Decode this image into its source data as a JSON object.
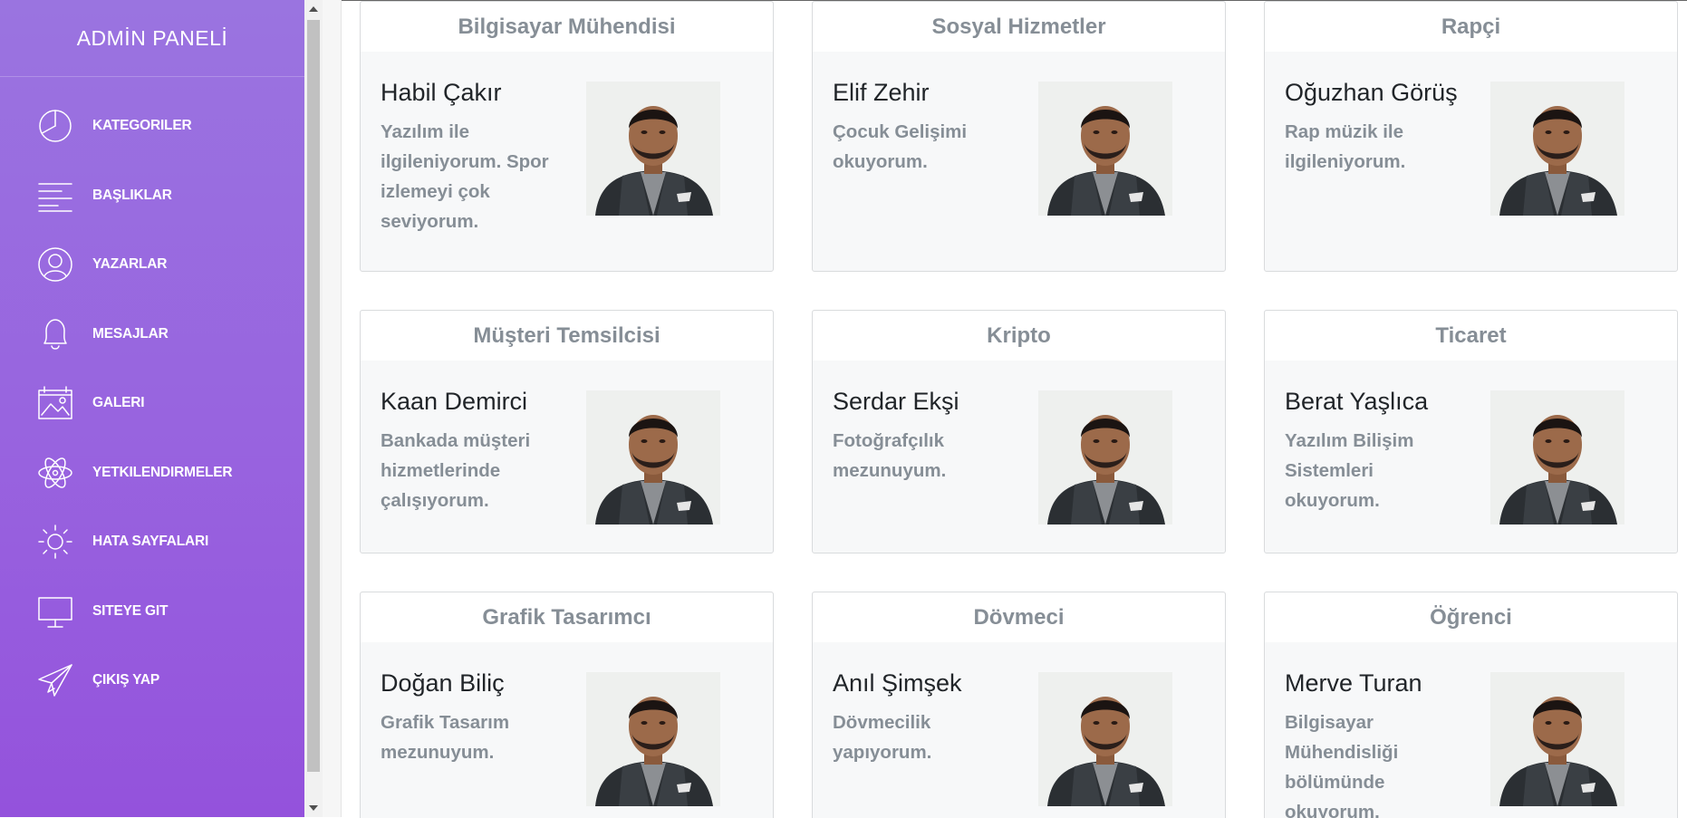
{
  "brand": {
    "title": "ADMİN PANELİ"
  },
  "nav": [
    {
      "label": "KATEGORILER",
      "icon": "pie-chart-icon"
    },
    {
      "label": "BAŞLIKLAR",
      "icon": "lines-icon"
    },
    {
      "label": "YAZARLAR",
      "icon": "user-icon"
    },
    {
      "label": "MESAJLAR",
      "icon": "bell-icon"
    },
    {
      "label": "GALERI",
      "icon": "gallery-icon"
    },
    {
      "label": "YETKILENDIRMELER",
      "icon": "atom-icon"
    },
    {
      "label": "HATA SAYFALARI",
      "icon": "sun-icon"
    },
    {
      "label": "SITEYE GIT",
      "icon": "monitor-icon"
    },
    {
      "label": "ÇIKIŞ YAP",
      "icon": "paper-plane-icon"
    }
  ],
  "cards": [
    {
      "title": "Bilgisayar Mühendisi",
      "name": "Habil Çakır",
      "desc": "Yazılım ile ilgileniyorum. Spor izlemeyi çok seviyorum."
    },
    {
      "title": "Sosyal Hizmetler",
      "name": "Elif Zehir",
      "desc": "Çocuk Gelişimi okuyorum."
    },
    {
      "title": "Rapçi",
      "name": "Oğuzhan Görüş",
      "desc": "Rap müzik ile ilgileniyorum."
    },
    {
      "title": "Müşteri Temsilcisi",
      "name": "Kaan Demirci",
      "desc": "Bankada müşteri hizmetlerinde çalışıyorum."
    },
    {
      "title": "Kripto",
      "name": "Serdar Ekşi",
      "desc": "Fotoğrafçılık mezunuyum."
    },
    {
      "title": "Ticaret",
      "name": "Berat Yaşlıca",
      "desc": "Yazılım Bilişim Sistemleri okuyorum."
    },
    {
      "title": "Grafik Tasarımcı",
      "name": "Doğan Biliç",
      "desc": "Grafik Tasarım mezunuyum."
    },
    {
      "title": "Dövmeci",
      "name": "Anıl Şimşek",
      "desc": "Dövmecilik yapıyorum."
    },
    {
      "title": "Öğrenci",
      "name": "Merve Turan",
      "desc": "Bilgisayar Mühendisliği bölümünde okuyorum."
    }
  ],
  "colors": {
    "sidebar_top": "#9a74e0",
    "sidebar_bottom": "#9452dc",
    "card_title": "#868e96",
    "card_bg": "#f7f8f9"
  }
}
